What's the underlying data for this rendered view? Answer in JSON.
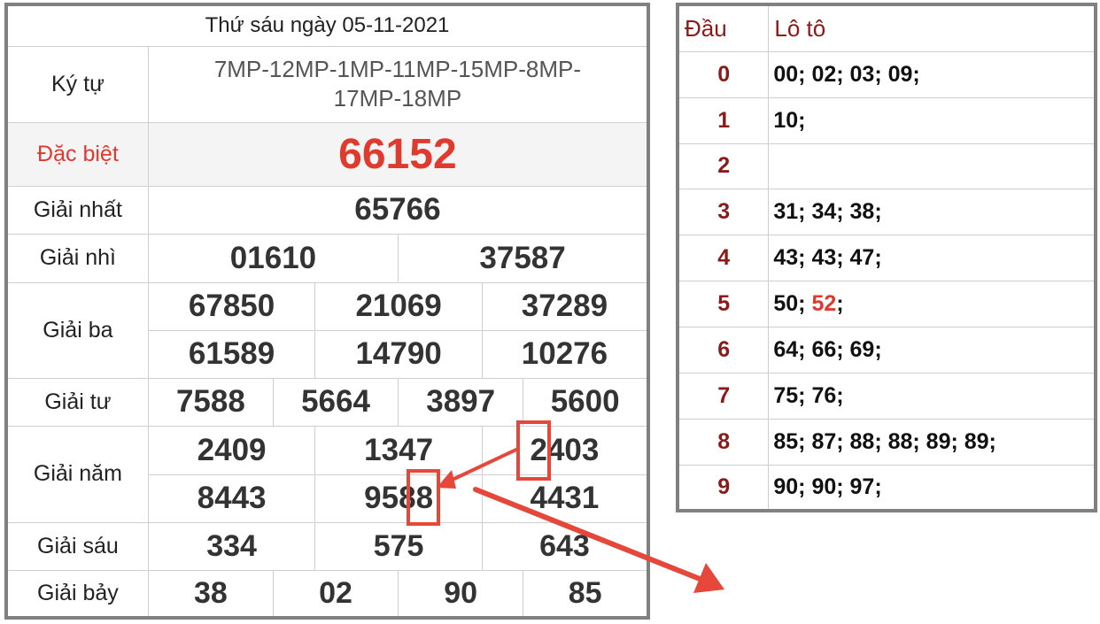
{
  "results": {
    "date_title": "Thứ sáu ngày 05-11-2021",
    "ky_tu": {
      "label": "Ký tự",
      "line1": "7MP-12MP-1MP-11MP-15MP-8MP-",
      "line2": "17MP-18MP"
    },
    "dac_biet": {
      "label": "Đặc biệt",
      "value": "66152"
    },
    "giai_nhat": {
      "label": "Giải nhất",
      "value": "65766"
    },
    "giai_nhi": {
      "label": "Giải nhì",
      "values": [
        "01610",
        "37587"
      ]
    },
    "giai_ba": {
      "label": "Giải ba",
      "values": [
        "67850",
        "21069",
        "37289",
        "61589",
        "14790",
        "10276"
      ]
    },
    "giai_tu": {
      "label": "Giải tư",
      "values": [
        "7588",
        "5664",
        "3897",
        "5600"
      ]
    },
    "giai_nam": {
      "label": "Giải năm",
      "values": [
        "2409",
        "1347",
        "2403",
        "8443",
        "9588",
        "4431"
      ]
    },
    "giai_sau": {
      "label": "Giải sáu",
      "values": [
        "334",
        "575",
        "643"
      ]
    },
    "giai_bay": {
      "label": "Giải bảy",
      "values": [
        "38",
        "02",
        "90",
        "85"
      ]
    }
  },
  "loto": {
    "header_dau": "Đầu",
    "header_loto": "Lô tô",
    "rows": [
      {
        "dau": "0",
        "values": "00; 02; 03; 09;"
      },
      {
        "dau": "1",
        "values": "10;"
      },
      {
        "dau": "2",
        "values": ""
      },
      {
        "dau": "3",
        "values": "31; 34; 38;"
      },
      {
        "dau": "4",
        "values": "43; 43; 47;"
      },
      {
        "dau": "5",
        "values_pre": "50; ",
        "values_hit": "52",
        "values_post": ";"
      },
      {
        "dau": "6",
        "values": "64; 66; 69;"
      },
      {
        "dau": "7",
        "values": "75; 76;"
      },
      {
        "dau": "8",
        "values": "85; 87; 88; 88; 89; 89;"
      },
      {
        "dau": "9",
        "values": "90; 90; 97;"
      }
    ]
  },
  "colors": {
    "special_red": "#e03a2f",
    "loto_head_red": "#8b1a1a",
    "annotation_red": "#e5473b",
    "frame_gray": "#808080"
  }
}
